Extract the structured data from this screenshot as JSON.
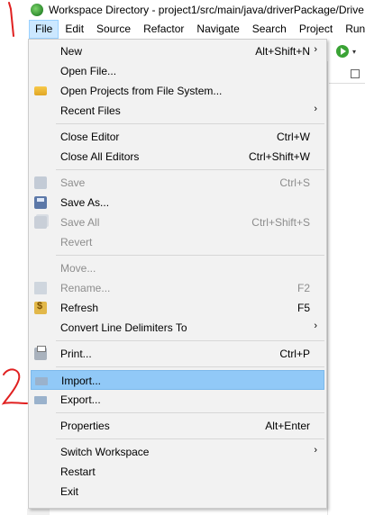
{
  "window": {
    "title": "Workspace Directory - project1/src/main/java/driverPackage/Drive"
  },
  "menubar": {
    "items": [
      "File",
      "Edit",
      "Source",
      "Refactor",
      "Navigate",
      "Search",
      "Project",
      "Run"
    ],
    "active": "File"
  },
  "file_menu": {
    "new": {
      "label": "New",
      "shortcut": "Alt+Shift+N",
      "submenu_arrow": "›"
    },
    "open_file": {
      "label": "Open File..."
    },
    "open_projects": {
      "label": "Open Projects from File System...",
      "icon": "folder-icon"
    },
    "recent_files": {
      "label": "Recent Files",
      "submenu_arrow": "›"
    },
    "close_editor": {
      "label": "Close Editor",
      "shortcut": "Ctrl+W"
    },
    "close_all_editors": {
      "label": "Close All Editors",
      "shortcut": "Ctrl+Shift+W"
    },
    "save": {
      "label": "Save",
      "shortcut": "Ctrl+S",
      "enabled": false
    },
    "save_as": {
      "label": "Save As...",
      "enabled": true
    },
    "save_all": {
      "label": "Save All",
      "shortcut": "Ctrl+Shift+S",
      "enabled": false
    },
    "revert": {
      "label": "Revert",
      "enabled": false
    },
    "move": {
      "label": "Move...",
      "enabled": false
    },
    "rename": {
      "label": "Rename...",
      "shortcut": "F2",
      "enabled": false
    },
    "refresh": {
      "label": "Refresh",
      "shortcut": "F5"
    },
    "convert_line_delimiters": {
      "label": "Convert Line Delimiters To",
      "submenu_arrow": "›"
    },
    "print": {
      "label": "Print...",
      "shortcut": "Ctrl+P"
    },
    "import": {
      "label": "Import...",
      "highlighted": true
    },
    "export": {
      "label": "Export..."
    },
    "properties": {
      "label": "Properties",
      "shortcut": "Alt+Enter"
    },
    "switch_workspace": {
      "label": "Switch Workspace",
      "submenu_arrow": "›"
    },
    "restart": {
      "label": "Restart"
    },
    "exit": {
      "label": "Exit"
    }
  },
  "toolbar": {
    "run_dropdown_arrow": "▾"
  },
  "colors": {
    "highlight": "#91c9f7",
    "menu_bg": "#f2f2f2",
    "annotation": "#e02020",
    "disabled_text": "#8d8d8d"
  }
}
